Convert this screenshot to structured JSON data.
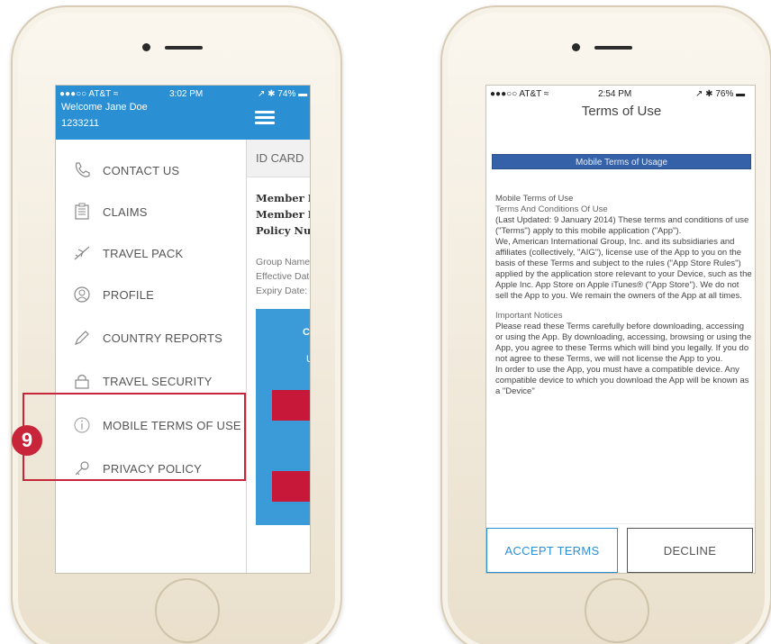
{
  "step_number": "9",
  "colors": {
    "brand_blue": "#2b8fd4",
    "highlight_red": "#c8253a",
    "terms_banner": "#3561a8",
    "button_red": "#c8183a"
  },
  "left_phone": {
    "status": {
      "carrier": "●●●○○ AT&T ≈",
      "time": "3:02 PM",
      "battery": "↗ ✱ 74% ▬"
    },
    "drawer": {
      "welcome": "Welcome Jane Doe",
      "member_number": "1233211",
      "items": [
        {
          "label": "CONTACT US",
          "icon": "phone-icon"
        },
        {
          "label": "CLAIMS",
          "icon": "clipboard-icon"
        },
        {
          "label": "TRAVEL PACK",
          "icon": "airplane-icon"
        },
        {
          "label": "PROFILE",
          "icon": "profile-icon"
        },
        {
          "label": "COUNTRY REPORTS",
          "icon": "pen-icon"
        },
        {
          "label": "TRAVEL SECURITY",
          "icon": "lock-icon"
        },
        {
          "label": "MOBILE TERMS OF USE",
          "icon": "info-icon"
        },
        {
          "label": "PRIVACY POLICY",
          "icon": "key-icon"
        }
      ]
    },
    "panel": {
      "section": "ID CARD",
      "bold_lines": [
        "Member ID C",
        "Member Na",
        "Policy Numb"
      ],
      "small_lines": [
        "Group Name:",
        "Effective Date:",
        "Expiry Date:"
      ],
      "box_title": "CA",
      "box_sub": "U."
    }
  },
  "right_phone": {
    "status": {
      "carrier": "●●●○○ AT&T ≈",
      "time": "2:54 PM",
      "battery": "↗ ✱ 76% ▬"
    },
    "title": "Terms of Use",
    "banner": "Mobile Terms of Usage",
    "body": {
      "heading": "Mobile Terms of Use",
      "subheading": "Terms And Conditions Of Use",
      "para1": "(Last Updated: 9 January 2014) These terms and conditions of use (\"Terms\") apply to this mobile application (\"App\").",
      "para2": "We, American International Group, Inc. and its subsidiaries and affiliates (collectively, \"AIG\"), license use of the App to you on the basis of these Terms and subject to the rules (\"App Store Rules\") applied by the application store relevant to your Device, such as the Apple Inc. App Store on Apple iTunes® (\"App Store\"). We do not sell the App to you. We remain the owners of the App at all times.",
      "notices_heading": "Important Notices",
      "para3": "Please read these Terms carefully before downloading, accessing or using the App. By downloading, accessing, browsing or using the App, you agree to these Terms which will bind you legally. If you do not agree to these Terms, we will not license the App to you.",
      "para4": "In order to use the App, you must have a compatible device. Any compatible device to which you download the App will be known as a \"Device\""
    },
    "buttons": {
      "accept": "ACCEPT TERMS",
      "decline": "DECLINE"
    }
  }
}
